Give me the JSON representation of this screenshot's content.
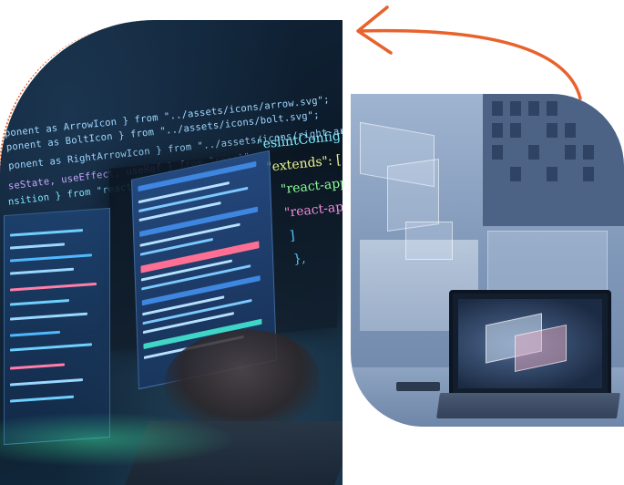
{
  "code_lines": [
    "ponent as ArrowIcon } from \"../assets/icons/arrow.svg\";",
    "ponent as BoltIcon } from \"../assets/icons/bolt.svg\";",
    "ponent as RightArrowIcon } from \"../assets/icons/right-arrow.svg\";",
    "seState, useEffect, useRef } from \"react\";",
    "nsition } from \"react-transition-group\";"
  ],
  "json_config": {
    "line1": "\"eslintConfig\": {",
    "line2": "\"extends\": [",
    "line3": "\"react-app\"",
    "line4": "\"react-ap",
    "line5": "]",
    "line6": "},"
  },
  "colors": {
    "accent_orange": "#e8622c",
    "code_blue": "#9fd8ff",
    "right_tint": "#7f97b8"
  }
}
